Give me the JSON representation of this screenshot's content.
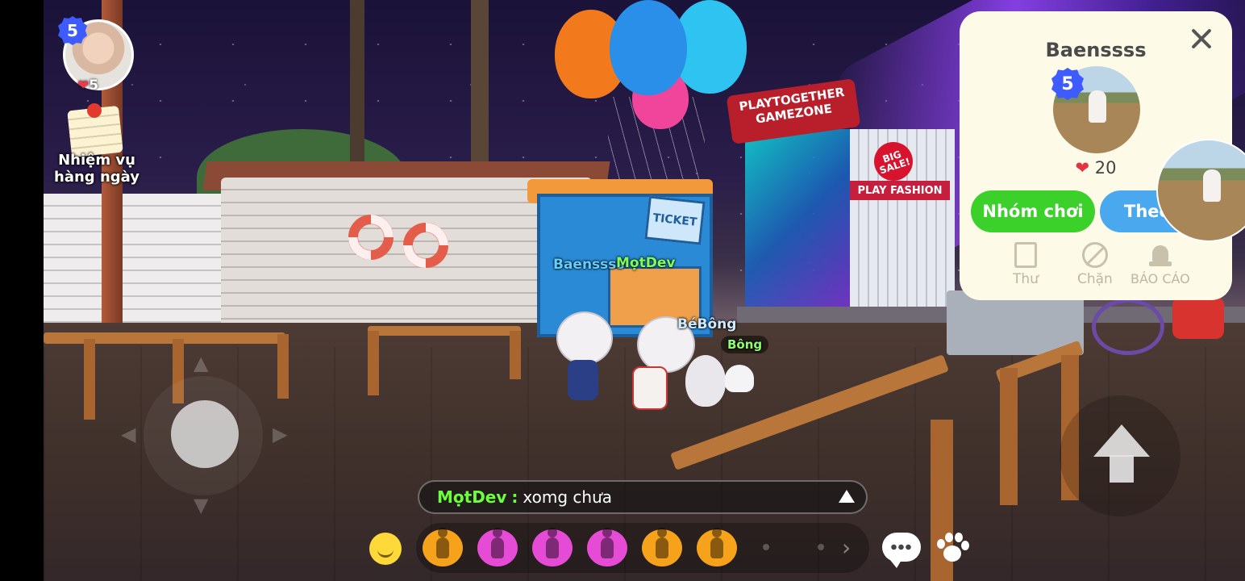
{
  "player": {
    "level": "5",
    "hearts": "5"
  },
  "quest": {
    "label_line1": "Nhiệm vụ",
    "label_line2": "hàng ngày"
  },
  "scene": {
    "ticket_sign": "TICKET",
    "gamezone_line1": "PLAYTOGETHER",
    "gamezone_line2": "GAMEZONE",
    "fashion_sign": "PLAY FASHION",
    "sale_sign": "BIG SALE!"
  },
  "nametags": {
    "baenssss": "Baenssss",
    "motdev": "MọtDev",
    "bebong": "BéBông",
    "bong": "Bông"
  },
  "chat": {
    "sender": "MọtDev",
    "separator": ":",
    "message": "xomg chưa"
  },
  "emotes": [
    {
      "name": "emote-1",
      "color": "#f7a21b"
    },
    {
      "name": "emote-2",
      "color": "#e64bd6"
    },
    {
      "name": "emote-3",
      "color": "#e64bd6"
    },
    {
      "name": "emote-4",
      "color": "#e64bd6"
    },
    {
      "name": "emote-5",
      "color": "#f7a21b"
    },
    {
      "name": "emote-6",
      "color": "#f7a21b"
    }
  ],
  "profile_popup": {
    "username": "Baenssss",
    "level": "5",
    "likes": "20",
    "group_button": "Nhóm chơi",
    "follow_button": "Theo",
    "actions": {
      "mail": "Thư",
      "block": "Chặn",
      "report": "BÁO CÁO"
    }
  },
  "colors": {
    "accent_green": "#3bd02a",
    "accent_blue": "#4aa8ee",
    "badge_blue": "#3d5bff",
    "chat_name_green": "#6cff3c"
  }
}
